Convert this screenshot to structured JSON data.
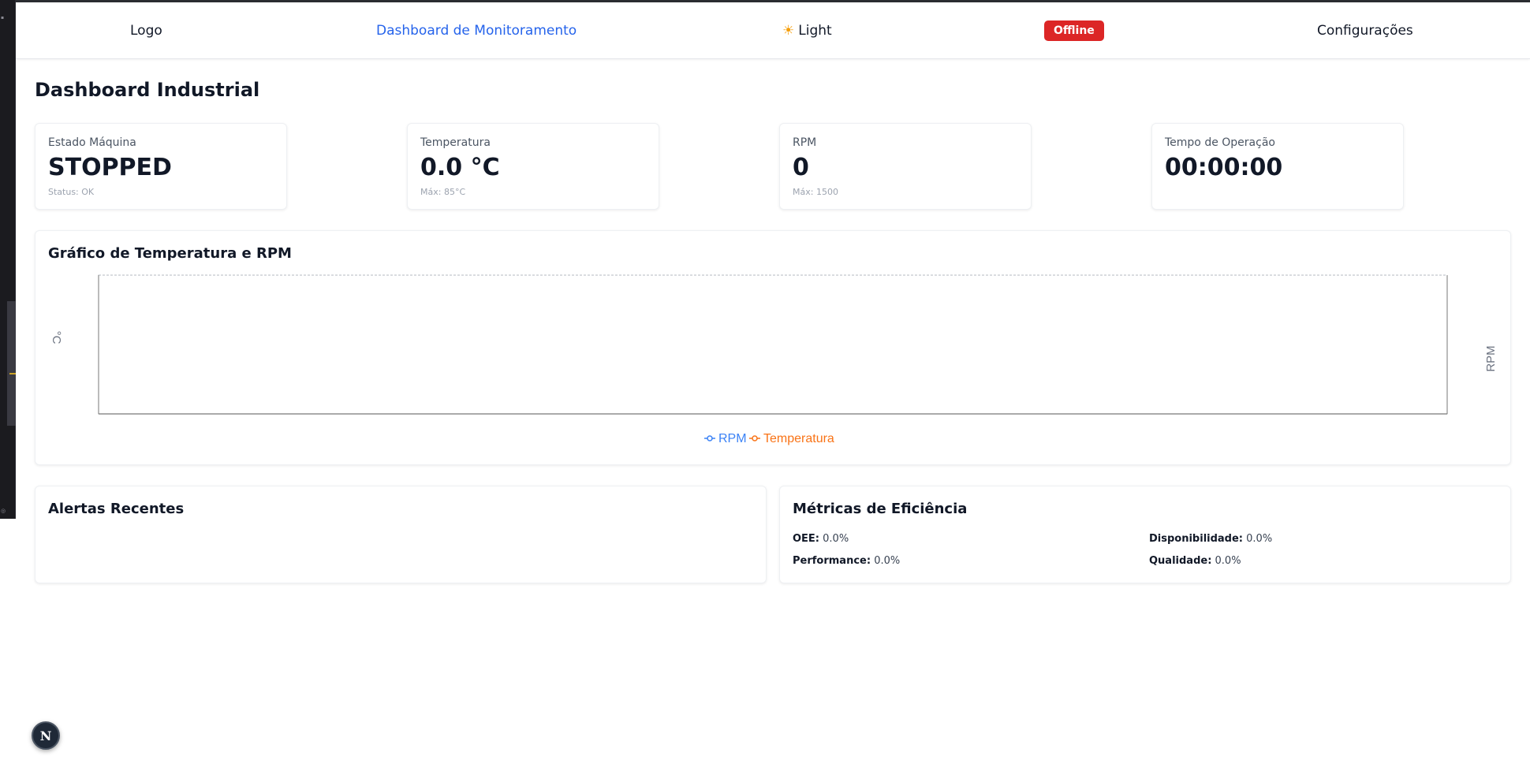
{
  "nav": {
    "logo": "Logo",
    "dashboard_link": "Dashboard de Monitoramento",
    "theme_icon": "sun-icon",
    "theme_label": "Light",
    "status_badge": "Offline",
    "config_link": "Configurações"
  },
  "page_title": "Dashboard Industrial",
  "stats": [
    {
      "label": "Estado Máquina",
      "value": "STOPPED",
      "sub": "Status: OK"
    },
    {
      "label": "Temperatura",
      "value": "0.0 °C",
      "sub": "Máx: 85°C"
    },
    {
      "label": "RPM",
      "value": "0",
      "sub": "Máx: 1500"
    },
    {
      "label": "Tempo de Operação",
      "value": "00:00:00",
      "sub": ""
    }
  ],
  "chart": {
    "title": "Gráfico de Temperatura e RPM"
  },
  "chart_data": {
    "type": "line",
    "title": "Gráfico de Temperatura e RPM",
    "ylabel": "°C",
    "y2label": "RPM",
    "x": [],
    "series": [
      {
        "name": "RPM",
        "axis": "right",
        "color": "#3b82f6",
        "values": []
      },
      {
        "name": "Temperatura",
        "axis": "left",
        "color": "#f97316",
        "values": []
      }
    ],
    "legend_position": "bottom-center",
    "grid": true
  },
  "alerts": {
    "title": "Alertas Recentes",
    "items": []
  },
  "metrics": {
    "title": "Métricas de Eficiência",
    "oee_label": "OEE:",
    "oee_value": "0.0%",
    "availability_label": "Disponibilidade:",
    "availability_value": "0.0%",
    "performance_label": "Performance:",
    "performance_value": "0.0%",
    "quality_label": "Qualidade:",
    "quality_value": "0.0%"
  },
  "fab": {
    "label": "N"
  },
  "colors": {
    "accent": "#2563eb",
    "offline": "#dc2626",
    "rpm": "#3b82f6",
    "temperature": "#f97316"
  }
}
